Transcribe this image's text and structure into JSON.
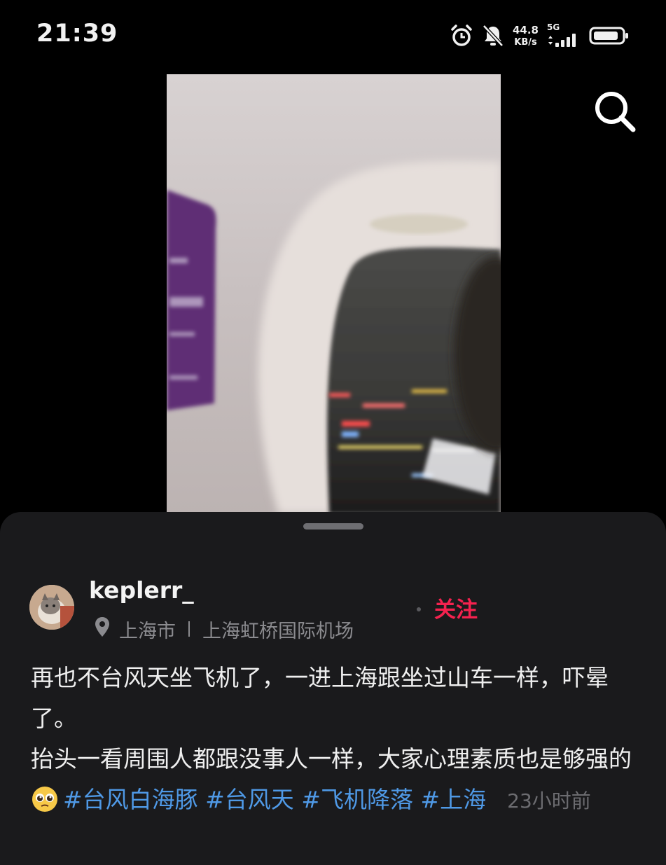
{
  "status_bar": {
    "time": "21:39",
    "net_speed_value": "44.8",
    "net_speed_unit": "KB/s",
    "network_type": "5G",
    "icons": [
      "alarm-icon",
      "bell-muted-icon",
      "signal-icon",
      "battery-icon"
    ]
  },
  "search": {
    "icon": "search-icon"
  },
  "post": {
    "username": "keplerr_",
    "location": {
      "city": "上海市",
      "place": "上海虹桥国际机场"
    },
    "follow_label": "关注",
    "caption_line1": "再也不台风天坐飞机了，一进上海跟坐过山车一样，吓晕了。",
    "caption_line2": "抬头一看周围人都跟没事人一样，大家心理素质也是够强的",
    "hashtags": [
      "#台风白海豚",
      "#台风天",
      "#飞机降落",
      "#上海"
    ],
    "time_ago": "23小时前"
  },
  "colors": {
    "accent_follow": "#f5224f",
    "hashtag": "#4f99e6",
    "sheet_bg": "#1a1a1c"
  }
}
